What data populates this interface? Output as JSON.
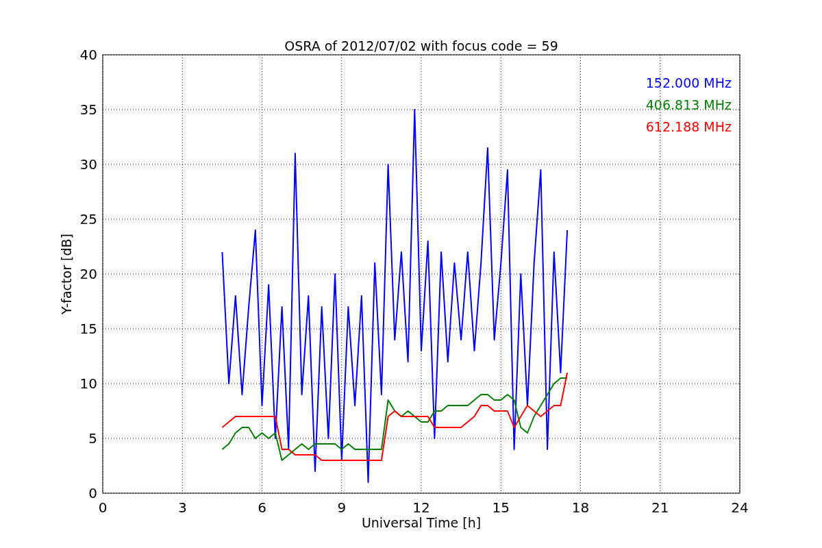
{
  "chart_data": {
    "type": "line",
    "title": "OSRA of 2012/07/02 with focus code = 59",
    "xlabel": "Universal Time [h]",
    "ylabel": "Y-factor [dB]",
    "x": [
      4.5,
      4.75,
      5,
      5.25,
      5.5,
      5.75,
      6,
      6.25,
      6.5,
      6.75,
      7,
      7.25,
      7.5,
      7.75,
      8,
      8.25,
      8.5,
      8.75,
      9,
      9.25,
      9.5,
      9.75,
      10,
      10.25,
      10.5,
      10.75,
      11,
      11.25,
      11.5,
      11.75,
      12,
      12.25,
      12.5,
      12.75,
      13,
      13.25,
      13.5,
      13.75,
      14,
      14.25,
      14.5,
      14.75,
      15,
      15.25,
      15.5,
      15.75,
      16,
      16.25,
      16.5,
      16.75,
      17,
      17.25,
      17.5
    ],
    "series": [
      {
        "name": "152.000 MHz",
        "color": "#0000ff",
        "values": [
          22,
          10,
          18,
          9,
          17,
          24,
          8,
          19,
          5,
          17,
          4,
          31,
          9,
          18,
          2,
          17,
          5,
          20,
          3,
          17,
          8,
          18,
          1,
          21,
          9,
          30,
          14,
          22,
          12,
          35,
          13,
          23,
          5,
          22,
          12,
          21,
          14,
          22,
          13,
          21,
          31.5,
          14,
          21,
          29.5,
          4,
          20,
          8,
          21,
          29.5,
          4,
          22,
          11,
          24
        ]
      },
      {
        "name": "406.813 MHz",
        "color": "#008000",
        "values": [
          4,
          4.5,
          5.5,
          6,
          6,
          5,
          5.5,
          5,
          5.5,
          3,
          3.5,
          4,
          4.5,
          4,
          4.5,
          4.5,
          4.5,
          4.5,
          4,
          4.5,
          4,
          4,
          4,
          4,
          4,
          8.5,
          7.5,
          7,
          7.5,
          7,
          6.5,
          6.5,
          7.5,
          7.5,
          8,
          8,
          8,
          8,
          8.5,
          9,
          9,
          8.5,
          8.5,
          9,
          8.5,
          6,
          5.5,
          7,
          8,
          9,
          10,
          10.5,
          10.5
        ]
      },
      {
        "name": "612.188 MHz",
        "color": "#ff0000",
        "values": [
          6,
          6.5,
          7,
          7,
          7,
          7,
          7,
          7,
          7,
          4,
          4,
          3.5,
          3.5,
          3.5,
          3.5,
          3,
          3,
          3,
          3,
          3,
          3,
          3,
          3,
          3,
          3,
          7,
          7.5,
          7,
          7,
          7,
          7,
          7,
          6,
          6,
          6,
          6,
          6,
          6.5,
          7,
          8,
          8,
          7.5,
          7.5,
          7.5,
          6,
          7,
          8,
          7.5,
          7,
          7.5,
          8,
          8,
          11
        ]
      }
    ],
    "grid": true,
    "xlim": [
      0,
      24
    ],
    "ylim": [
      0,
      40
    ],
    "xticks": [
      0,
      3,
      6,
      9,
      12,
      15,
      18,
      21,
      24
    ],
    "yticks": [
      0,
      5,
      10,
      15,
      20,
      25,
      30,
      35,
      40
    ]
  }
}
